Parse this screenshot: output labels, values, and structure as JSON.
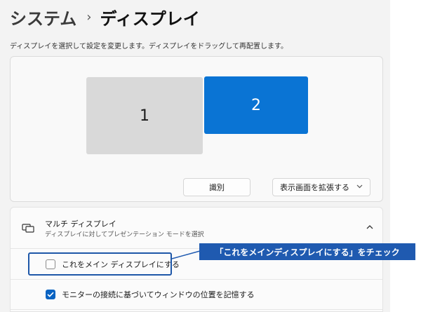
{
  "breadcrumb": {
    "parent": "システム",
    "separator": "›",
    "current": "ディスプレイ"
  },
  "description": "ディスプレイを選択して設定を変更します。ディスプレイをドラッグして再配置します。",
  "monitors": [
    {
      "label": "1",
      "selected": false
    },
    {
      "label": "2",
      "selected": true
    }
  ],
  "buttons": {
    "identify": "識別",
    "extend": "表示画面を拡張する"
  },
  "multi_display": {
    "title": "マルチ ディスプレイ",
    "subtitle": "ディスプレイに対してプレゼンテーション モードを選択",
    "options": [
      {
        "label": "これをメイン ディスプレイにする",
        "checked": false
      },
      {
        "label": "モニターの接続に基づいてウィンドウの位置を記憶する",
        "checked": true
      }
    ]
  },
  "callout": "「これをメインディスプレイにする」をチェック",
  "colors": {
    "accent": "#0a74d4",
    "callout": "#1f5ab0",
    "checkbox": "#0a63c2"
  }
}
